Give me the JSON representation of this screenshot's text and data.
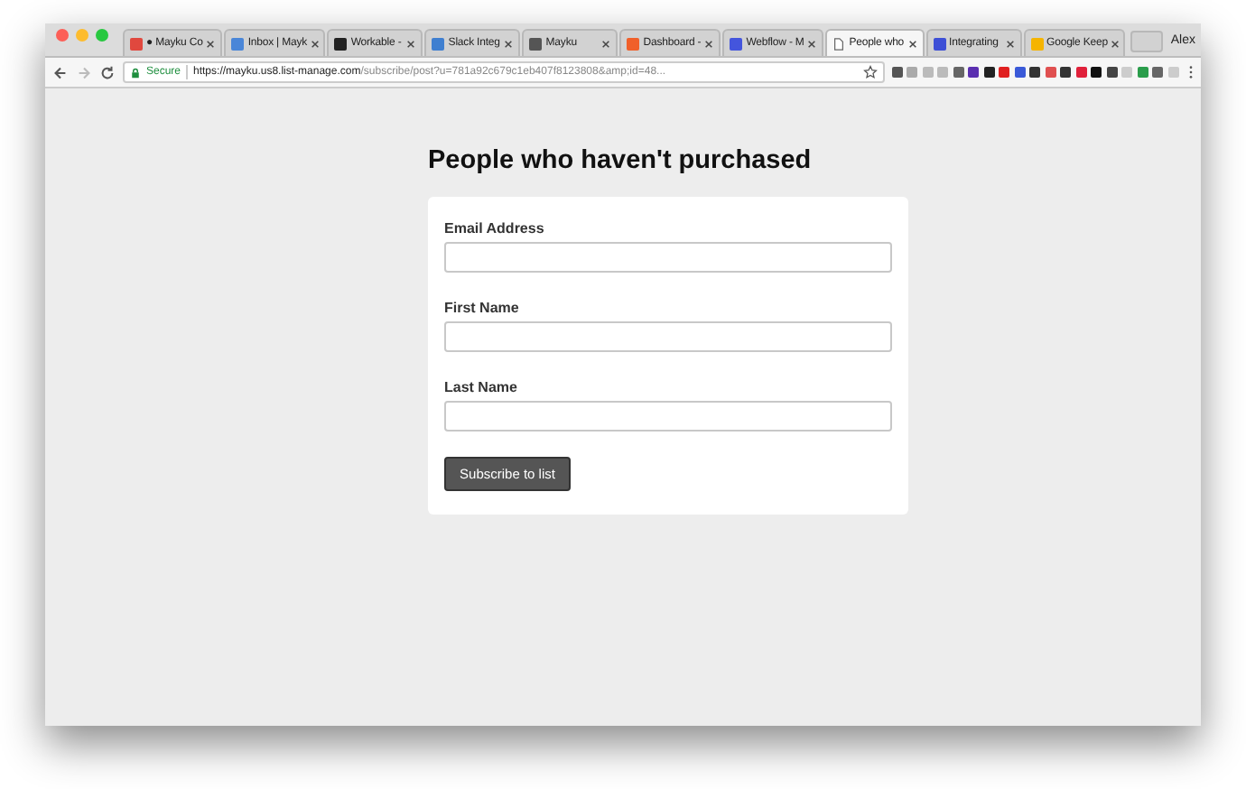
{
  "window": {
    "user": "Alex"
  },
  "tabs": [
    {
      "label": "● Mayku Co",
      "selected": false,
      "color": "#e0483e"
    },
    {
      "label": "Inbox | Mayk",
      "selected": false,
      "color": "#4a86d8"
    },
    {
      "label": "Workable -",
      "selected": false,
      "color": "#222222"
    },
    {
      "label": "Slack Integ",
      "selected": false,
      "color": "#3f7fd0"
    },
    {
      "label": "Mayku",
      "selected": false,
      "color": "#555555"
    },
    {
      "label": "Dashboard -",
      "selected": false,
      "color": "#f0602a"
    },
    {
      "label": "Webflow - M",
      "selected": false,
      "color": "#4455dd"
    },
    {
      "label": "People who",
      "selected": true,
      "color": "#ffffff"
    },
    {
      "label": "Integrating",
      "selected": false,
      "color": "#3d4fd6"
    },
    {
      "label": "Google Keep",
      "selected": false,
      "color": "#f5b400"
    }
  ],
  "toolbar": {
    "secure_label": "Secure",
    "url_host": "https://mayku.us8.list-manage.com",
    "url_rest": "/subscribe/post?u=781a92c679c1eb407f8123808&amp;id=48...",
    "extensions": [
      {
        "color": "#555555"
      },
      {
        "color": "#aaaaaa"
      },
      {
        "color": "#bbbbbb"
      },
      {
        "color": "#bbbbbb"
      },
      {
        "color": "#666666"
      },
      {
        "color": "#5b2fb0"
      },
      {
        "color": "#222222"
      },
      {
        "color": "#e02020"
      },
      {
        "color": "#3a5ad8"
      },
      {
        "color": "#333333"
      },
      {
        "color": "#e05050"
      },
      {
        "color": "#333333"
      },
      {
        "color": "#e0203a"
      },
      {
        "color": "#111111"
      },
      {
        "color": "#444444"
      },
      {
        "color": "#cccccc"
      },
      {
        "color": "#2a9d4b"
      },
      {
        "color": "#666666"
      },
      {
        "color": "#cccccc"
      }
    ]
  },
  "form": {
    "title": "People who haven't purchased",
    "fields": [
      {
        "label": "Email Address"
      },
      {
        "label": "First Name"
      },
      {
        "label": "Last Name"
      }
    ],
    "submit": "Subscribe to list"
  }
}
